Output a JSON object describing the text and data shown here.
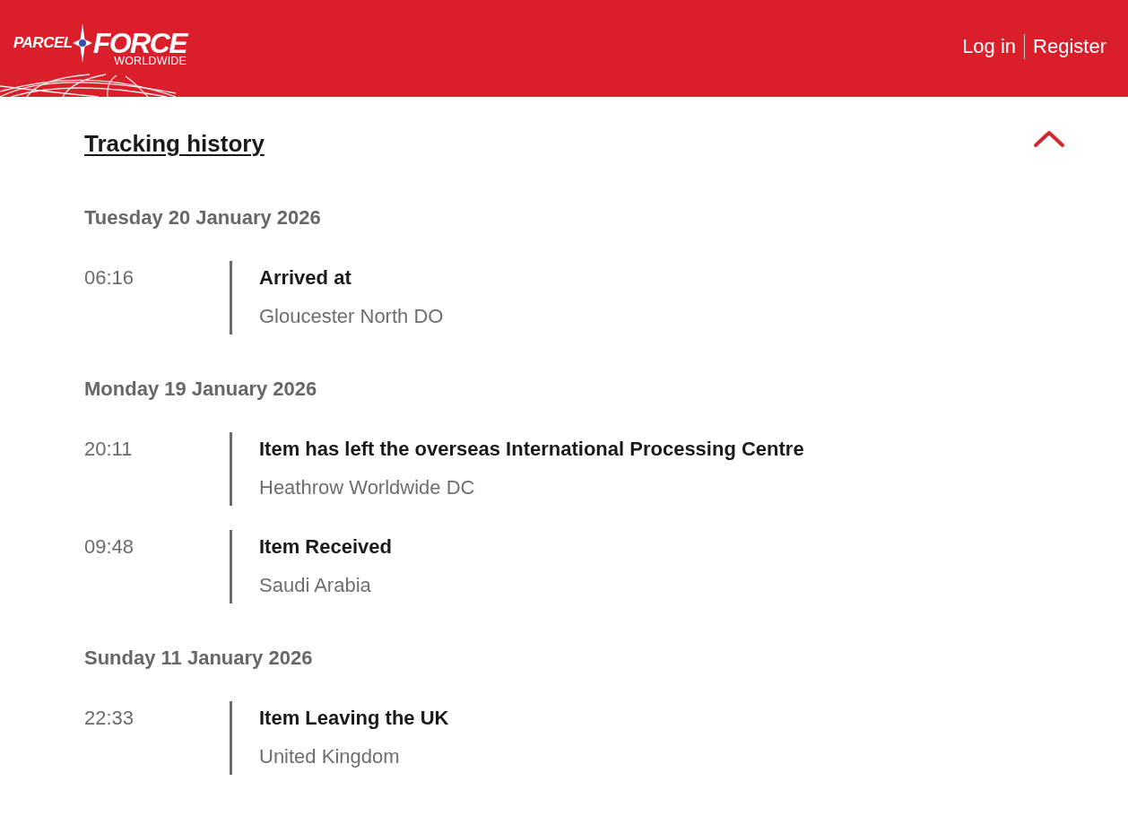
{
  "header": {
    "logo": {
      "word_1": "PARCEL",
      "word_2": "FORCE",
      "tagline": "WORLDWIDE"
    },
    "links": [
      {
        "label": "Log in"
      },
      {
        "label": "Register"
      }
    ]
  },
  "tracking_history": {
    "title": "Tracking history",
    "expanded": true,
    "days": [
      {
        "date": "Tuesday 20 January 2026",
        "events": [
          {
            "time": "06:16",
            "status": "Arrived at",
            "location": "Gloucester North DO"
          }
        ]
      },
      {
        "date": "Monday 19 January 2026",
        "events": [
          {
            "time": "20:11",
            "status": "Item has left the overseas International Processing Centre",
            "location": "Heathrow Worldwide DC"
          },
          {
            "time": "09:48",
            "status": "Item Received",
            "location": "Saudi Arabia"
          }
        ]
      },
      {
        "date": "Sunday 11 January 2026",
        "events": [
          {
            "time": "22:33",
            "status": "Item Leaving the UK",
            "location": "United Kingdom"
          }
        ]
      }
    ]
  }
}
